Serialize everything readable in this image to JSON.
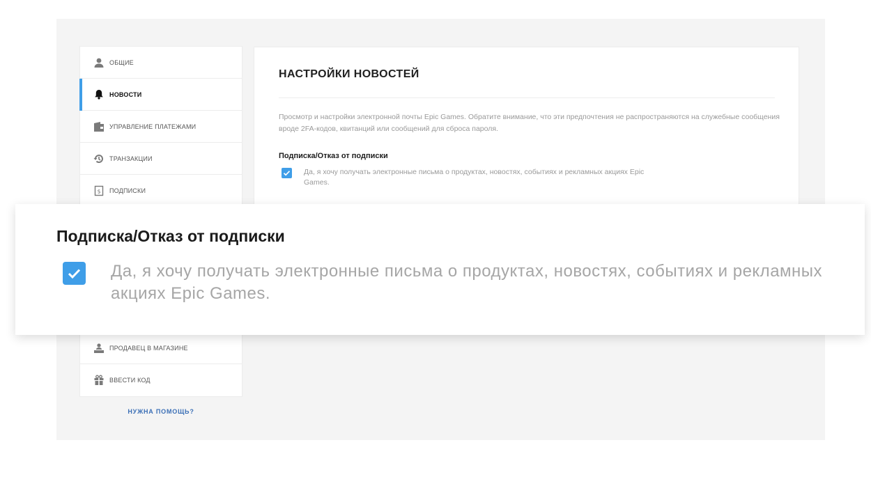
{
  "sidebar": {
    "items": [
      {
        "label": "ОБЩИЕ",
        "icon": "user-icon",
        "active": false
      },
      {
        "label": "НОВОСТИ",
        "icon": "bell-icon",
        "active": true
      },
      {
        "label": "УПРАВЛЕНИЕ ПЛАТЕЖАМИ",
        "icon": "wallet-icon",
        "active": false
      },
      {
        "label": "ТРАНЗАКЦИИ",
        "icon": "history-icon",
        "active": false
      },
      {
        "label": "ПОДПИСКИ",
        "icon": "subscription-icon",
        "active": false
      },
      {
        "label": "ПРОДАВЕЦ В МАГАЗИНЕ",
        "icon": "seller-icon",
        "active": false
      },
      {
        "label": "ВВЕСТИ КОД",
        "icon": "gift-icon",
        "active": false
      }
    ],
    "help_link": "НУЖНА ПОМОЩЬ?"
  },
  "main": {
    "title": "НАСТРОЙКИ НОВОСТЕЙ",
    "description": "Просмотр и настройки электронной почты Epic Games. Обратите внимание, что эти предпочтения не распространяются на служебные сообщения вроде 2FA-кодов, квитанций или сообщений для сброса пароля.",
    "subscription_heading": "Подписка/Отказ от подписки",
    "checkbox_label": "Да, я хочу получать электронные письма о продуктах, новостях, событиях и рекламных акциях Epic Games.",
    "checkbox_checked": true
  },
  "zoom_callout": {
    "heading": "Подписка/Отказ от подписки",
    "checkbox_label": "Да, я хочу получать электронные письма о продуктах, новостях, событиях и рекламных акциях Epic Games.",
    "checkbox_checked": true
  },
  "colors": {
    "accent": "#3f9ee8",
    "help_link": "#3b6fb6",
    "panel_bg": "#f4f4f4"
  }
}
